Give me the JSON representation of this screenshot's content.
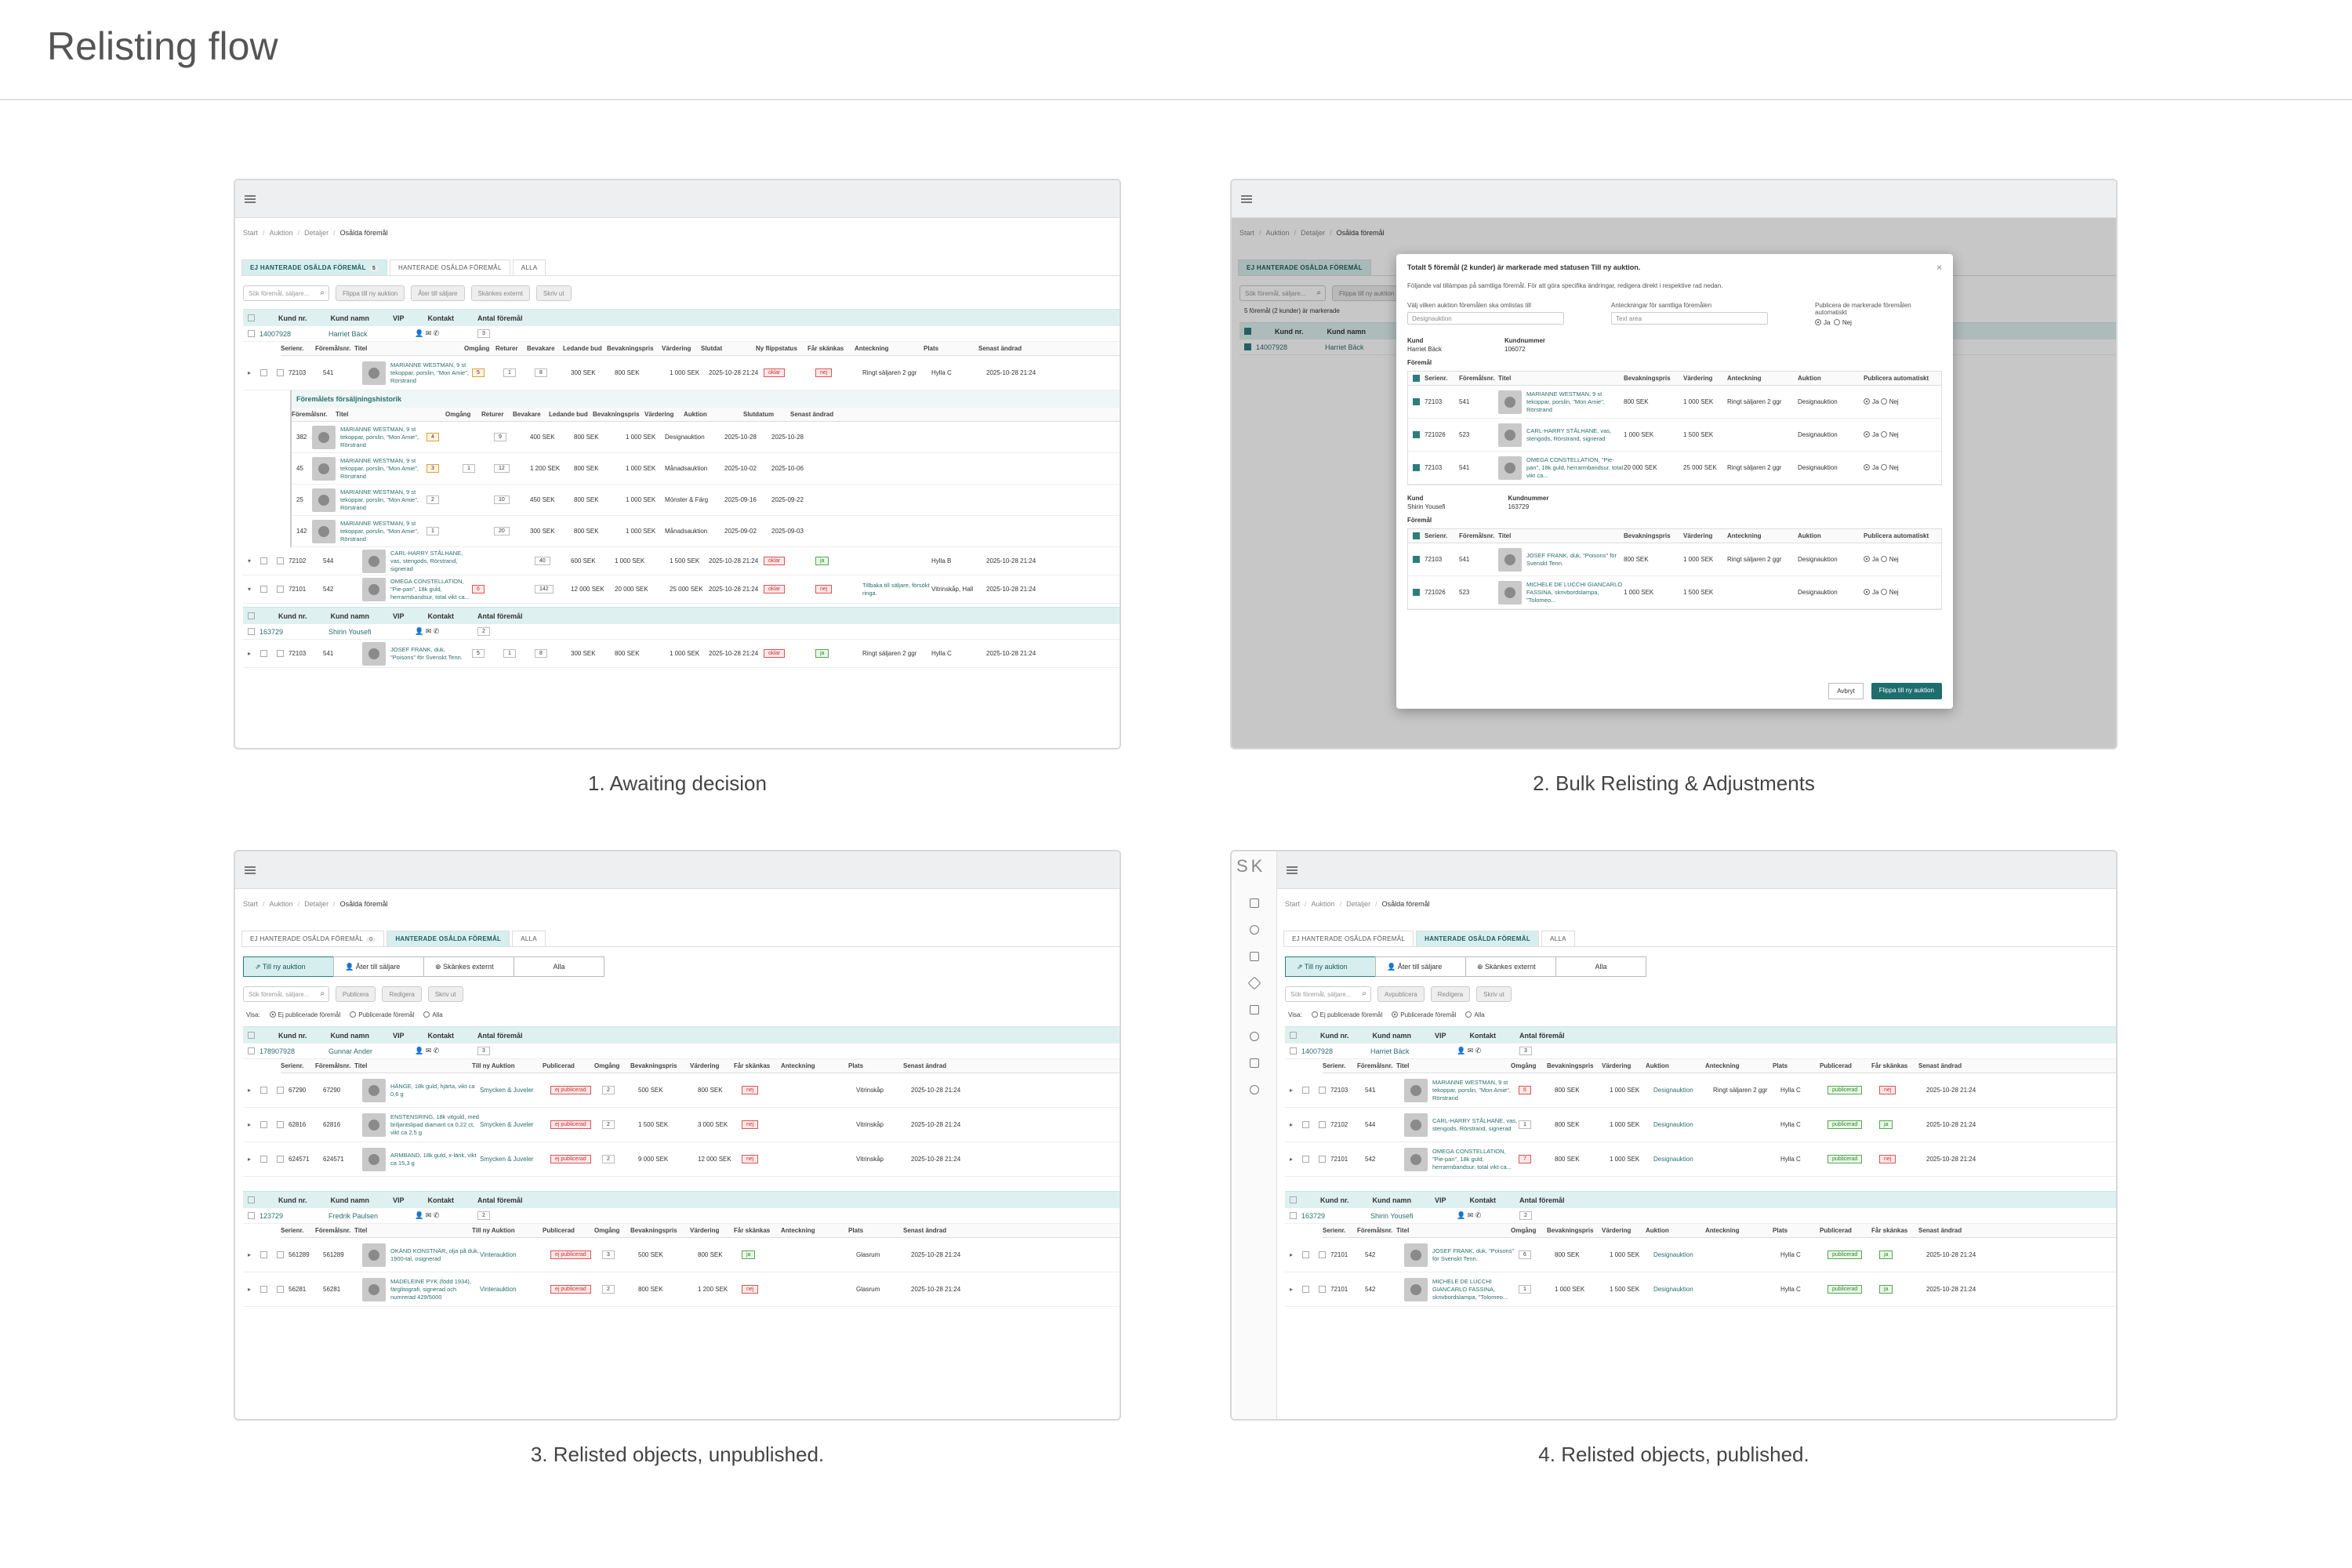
{
  "page": {
    "title": "Relisting flow"
  },
  "captions": [
    "1. Awaiting decision",
    "2. Bulk Relisting & Adjustments",
    "3. Relisted objects, unpublished.",
    "4. Relisted objects, published."
  ],
  "breadcrumb": [
    "Start",
    "Auktion",
    "Detaljer",
    "Osålda föremål"
  ],
  "tabs": {
    "unhandled": "EJ HANTERADE OSÅLDA FÖREMÅL",
    "handled": "HANTERADE OSÅLDA FÖREMÅL",
    "all": "ALLA",
    "unhandled_count": "5",
    "handled_count": "0"
  },
  "search": {
    "placeholder": "Sök föremål, säljare..."
  },
  "toolbar1": [
    "Flippa till ny auktion",
    "Åter till säljare",
    "Skänkes externt",
    "Skriv ut"
  ],
  "toolbar3": [
    "Publicera",
    "Redigera",
    "Skriv ut"
  ],
  "segments": [
    "Till ny auktion",
    "Åter till säljare",
    "Skänkes externt",
    "Alla"
  ],
  "visa": {
    "label": "Visa:",
    "opts": [
      "Ej publicerade föremål",
      "Publicerade föremål",
      "Alla"
    ]
  },
  "customer_cols": {
    "kund": "Kund nr.",
    "namn": "Kund namn",
    "vip": "VIP",
    "kontakt": "Kontakt",
    "antal": "Antal föremål"
  },
  "p1": {
    "cust1": {
      "nr": "14007928",
      "name": "Harriet Bäck",
      "count": "3"
    },
    "cust2": {
      "nr": "163729",
      "name": "Shirin Yousefi",
      "count": "2"
    },
    "cols": [
      "Serienr.",
      "Föremålsnr.",
      "Titel",
      "Omgång",
      "Returer",
      "Bevakare",
      "Ledande bud",
      "Bevakningspris",
      "Värdering",
      "Slutdat",
      "Ny flippstatus",
      "Får skänkas",
      "Anteckning",
      "Plats",
      "Senast ändrad"
    ],
    "rows": [
      {
        "s": "72103",
        "f": "541",
        "t": "MARIANNE WESTMAN, 9 st tekoppar, porslin, \"Mon Amie\", Rörstrand",
        "o": "5",
        "r": "1",
        "b": "8",
        "l": "300 SEK",
        "bp": "800 SEK",
        "v": "1 000 SEK",
        "d": "2025-10-28 21:24",
        "fs": "oklar",
        "sk": "nej",
        "a": "Ringt säljaren 2 ggr",
        "p": "Hylla C",
        "m": "2025-10-28 21:24"
      },
      {
        "s": "72102",
        "f": "544",
        "t": "CARL-HARRY STÅLHANE, vas, stengods, Rörstrand, signerad",
        "o": "",
        "r": "",
        "b": "40",
        "l": "600 SEK",
        "bp": "1 000 SEK",
        "v": "1 500 SEK",
        "d": "2025-10-28 21:24",
        "fs": "oklar",
        "sk": "ja",
        "a": "",
        "p": "Hylla B",
        "m": "2025-10-28 21:24"
      },
      {
        "s": "72101",
        "f": "542",
        "t": "OMEGA CONSTELLATION, \"Pie-pan\", 18k guld, herrarmbandsur, total vikt ca...",
        "o": "6",
        "r": "",
        "b": "142",
        "l": "12 000 SEK",
        "bp": "20 000 SEK",
        "v": "25 000 SEK",
        "d": "2025-10-28 21:24",
        "fs": "oklar",
        "sk": "nej",
        "a": "Tillbaka till säljare, försökt ringa.",
        "p": "Vitrinskåp, Hall",
        "m": "2025-10-28 21:24"
      }
    ],
    "row4": {
      "s": "72103",
      "f": "541",
      "t": "JOSEF FRANK, duk, \"Poisons\" för Svenskt Tenn.",
      "o": "5",
      "r": "1",
      "b": "8",
      "l": "300 SEK",
      "bp": "800 SEK",
      "v": "1 000 SEK",
      "d": "2025-10-28 21:24",
      "fs": "oklar",
      "sk": "ja",
      "a": "Ringt säljaren 2 ggr",
      "p": "Hylla C",
      "m": "2025-10-28 21:24"
    },
    "history": {
      "title": "Föremålets försäljningshistorik",
      "cols": [
        "Föremålsnr.",
        "Titel",
        "Omgång",
        "Returer",
        "Bevakare",
        "Ledande bud",
        "Bevakningspris",
        "Värdering",
        "Auktion",
        "Slutdatum",
        "Senast ändrad"
      ],
      "rows": [
        {
          "f": "382",
          "t": "MARIANNE WESTMAN, 9 st tekoppar, porslin, \"Mon Amie\", Rörstrand",
          "o": "4",
          "r": "",
          "b": "9",
          "l": "400 SEK",
          "bp": "800 SEK",
          "v": "1 000 SEK",
          "a": "Designauktion",
          "d": "2025-10-28",
          "m": "2025-10-28"
        },
        {
          "f": "45",
          "t": "MARIANNE WESTMAN, 9 st tekoppar, porslin, \"Mon Amie\", Rörstrand",
          "o": "3",
          "r": "1",
          "b": "12",
          "l": "1 200 SEK",
          "bp": "800 SEK",
          "v": "1 000 SEK",
          "a": "Månadsauktion",
          "d": "2025-10-02",
          "m": "2025-10-06"
        },
        {
          "f": "25",
          "t": "MARIANNE WESTMAN, 9 st tekoppar, porslin, \"Mon Amie\", Rörstrand",
          "o": "2",
          "r": "",
          "b": "10",
          "l": "450 SEK",
          "bp": "800 SEK",
          "v": "1 000 SEK",
          "a": "Mönster & Färg",
          "d": "2025-09-16",
          "m": "2025-09-22"
        },
        {
          "f": "142",
          "t": "MARIANNE WESTMAN, 9 st tekoppar, porslin, \"Mon Amie\", Rörstrand",
          "o": "1",
          "r": "",
          "b": "20",
          "l": "300 SEK",
          "bp": "800 SEK",
          "v": "1 000 SEK",
          "a": "Månadsauktion",
          "d": "2025-09-02",
          "m": "2025-09-03"
        }
      ]
    }
  },
  "p2": {
    "selection": "5 föremål (2 kunder) är markerade",
    "modal_title": "Totalt 5 föremål (2 kunder) är markerade med statusen Till ny auktion.",
    "modal_desc": "Följande val tillämpas på samtliga föremål. För att göra specifika ändringar, redigera direkt i respektive rad nedan.",
    "f1": "Välj vilken auktion föremålen ska omlistas till",
    "f1v": "Designauktion",
    "f2": "Anteckningar för samtliga föremålen",
    "f2v": "Text area",
    "f3": "Publicera de markerade föremålen automatiskt",
    "ja": "Ja",
    "nej": "Nej",
    "kund": "Kund",
    "kundnummer": "Kundnummer",
    "foremal": "Föremål",
    "cust1": {
      "name": "Harriet Bäck",
      "nr": "106072"
    },
    "cust2": {
      "name": "Shirin Yousefi",
      "nr": "163729"
    },
    "cols": [
      "Serienr.",
      "Föremålsnr.",
      "Titel",
      "Bevakningspris",
      "Värdering",
      "Anteckning",
      "Auktion",
      "Publicera automatiskt"
    ],
    "rows1": [
      {
        "s": "72103",
        "f": "541",
        "t": "MARIANNE WESTMAN, 9 st tekoppar, porslin, \"Mon Amie\", Rörstrand",
        "bp": "800 SEK",
        "v": "1 000 SEK",
        "a": "Ringt säljaren 2 ggr",
        "au": "Designauktion"
      },
      {
        "s": "721026",
        "f": "523",
        "t": "CARL-HARRY STÅLHANE, vas, stengods, Rörstrand, signerad",
        "bp": "1 000 SEK",
        "v": "1 500 SEK",
        "a": "",
        "au": "Designauktion"
      },
      {
        "s": "72103",
        "f": "541",
        "t": "OMEGA CONSTELLATION, \"Pie-pan\", 18k guld, herrarmbandsur, total vikt ca...",
        "bp": "20 000 SEK",
        "v": "25 000 SEK",
        "a": "Ringt säljaren 2 ggr",
        "au": "Designauktion"
      }
    ],
    "rows2": [
      {
        "s": "72103",
        "f": "541",
        "t": "JOSEF FRANK, duk, \"Poisons\" för Svenskt Tenn.",
        "bp": "800 SEK",
        "v": "1 000 SEK",
        "a": "Ringt säljaren 2 ggr",
        "au": "Designauktion"
      },
      {
        "s": "721026",
        "f": "523",
        "t": "MICHELE DE LUCCHI GIANCARLO FASSINA, skrivbordslampa, \"Tolomeo...",
        "bp": "1 000 SEK",
        "v": "1 500 SEK",
        "a": "",
        "au": "Designauktion"
      }
    ],
    "cancel": "Avbryt",
    "confirm": "Flippa till ny auktion"
  },
  "p3": {
    "cust1": {
      "nr": "178907928",
      "name": "Gunnar Ander",
      "count": "3"
    },
    "cust2": {
      "nr": "123729",
      "name": "Fredrik Paulsen",
      "count": "2"
    },
    "cols": [
      "Serienr.",
      "Föremålsnr.",
      "Titel",
      "Till ny Auktion",
      "Publicerad",
      "Omgång",
      "Bevakningspris",
      "Värdering",
      "Får skänkas",
      "Anteckning",
      "Plats",
      "Senast ändrad"
    ],
    "rows1": [
      {
        "s": "67290",
        "f": "67290",
        "t": "HÄNGE, 18k guld, hjärta, vikt ca 0,6 g",
        "au": "Smycken & Juveler",
        "pub": "ej publicerad",
        "o": "2",
        "bp": "500 SEK",
        "v": "800 SEK",
        "sk": "nej",
        "p": "Vitrinskåp",
        "m": "2025-10-28 21:24"
      },
      {
        "s": "62816",
        "f": "62816",
        "t": "ENSTENSRING, 18k vitguld, med briljantslipad diamant ca 0,22 ct, vikt ca 2,5 g",
        "au": "Smycken & Juveler",
        "pub": "ej publicerad",
        "o": "2",
        "bp": "1 500 SEK",
        "v": "3 000 SEK",
        "sk": "nej",
        "p": "Vitrinskåp",
        "m": "2025-10-28 21:24"
      },
      {
        "s": "624571",
        "f": "624571",
        "t": "ARMBAND, 18k guld, x-länk, vikt ca 15,3 g",
        "au": "Smycken & Juveler",
        "pub": "ej publicerad",
        "o": "2",
        "bp": "9 000 SEK",
        "v": "12 000 SEK",
        "sk": "nej",
        "p": "Vitrinskåp",
        "m": "2025-10-28 21:24"
      }
    ],
    "rows2": [
      {
        "s": "561289",
        "f": "561289",
        "t": "OKÄND KONSTNÄR, olja på duk, 1900-tal, osignerad",
        "au": "Vinterauktion",
        "pub": "ej publicerad",
        "o": "3",
        "bp": "500 SEK",
        "v": "800 SEK",
        "sk": "ja",
        "p": "Glasrum",
        "m": "2025-10-28 21:24"
      },
      {
        "s": "56281",
        "f": "56281",
        "t": "MADELEINE PYK (född 1934), färglitografi, signerad och numrerad 429/5000",
        "au": "Vinterauktion",
        "pub": "ej publicerad",
        "o": "2",
        "bp": "800 SEK",
        "v": "1 200 SEK",
        "sk": "nej",
        "p": "Glasrum",
        "m": "2025-10-28 21:24"
      }
    ]
  },
  "p4": {
    "logo": "SK",
    "toolbar": [
      "Avpublicera",
      "Redigera",
      "Skriv ut"
    ],
    "cust1": {
      "nr": "14007928",
      "name": "Harriet Bäck",
      "count": "3"
    },
    "cust2": {
      "nr": "163729",
      "name": "Shirin Yousefi",
      "count": "2"
    },
    "cols": [
      "Serienr.",
      "Föremålsnr.",
      "Titel",
      "Omgång",
      "Bevakningspris",
      "Värdering",
      "Auktion",
      "Anteckning",
      "Plats",
      "Publicerad",
      "Får skänkas",
      "Senast ändrad"
    ],
    "rows1": [
      {
        "s": "72103",
        "f": "541",
        "t": "MARIANNE WESTMAN, 9 st tekoppar, porslin, \"Mon Amie\", Rörstrand",
        "o": "6",
        "bp": "800 SEK",
        "v": "1 000 SEK",
        "au": "Designauktion",
        "a": "Ringt säljaren 2 ggr",
        "p": "Hylla C",
        "pub": "publicerad",
        "sk": "nej",
        "m": "2025-10-28 21:24"
      },
      {
        "s": "72102",
        "f": "544",
        "t": "CARL-HARRY STÅLHANE, vas, stengods, Rörstrand, signerad",
        "o": "1",
        "bp": "800 SEK",
        "v": "1 000 SEK",
        "au": "Designauktion",
        "a": "",
        "p": "Hylla C",
        "pub": "publicerad",
        "sk": "ja",
        "m": "2025-10-28 21:24"
      },
      {
        "s": "72101",
        "f": "542",
        "t": "OMEGA CONSTELLATION, \"Pie-pan\", 18k guld, herrarmbandsur, total vikt ca...",
        "o": "7",
        "bp": "800 SEK",
        "v": "1 000 SEK",
        "au": "Designauktion",
        "a": "",
        "p": "Hylla C",
        "pub": "publicerad",
        "sk": "nej",
        "m": "2025-10-28 21:24"
      }
    ],
    "rows2": [
      {
        "s": "72101",
        "f": "542",
        "t": "JOSEF FRANK, duk, \"Poisons\" för Svenskt Tenn.",
        "o": "6",
        "bp": "800 SEK",
        "v": "1 000 SEK",
        "au": "Designauktion",
        "a": "",
        "p": "Hylla C",
        "pub": "publicerad",
        "sk": "ja",
        "m": "2025-10-28 21:24"
      },
      {
        "s": "72101",
        "f": "542",
        "t": "MICHELE DE LUCCHI GIANCARLO FASSINA, skrivbordslampa, \"Tolomeo...",
        "o": "1",
        "bp": "1 000 SEK",
        "v": "1 500 SEK",
        "au": "Designauktion",
        "a": "",
        "p": "Hylla C",
        "pub": "publicerad",
        "sk": "ja",
        "m": "2025-10-28 21:24"
      }
    ]
  }
}
